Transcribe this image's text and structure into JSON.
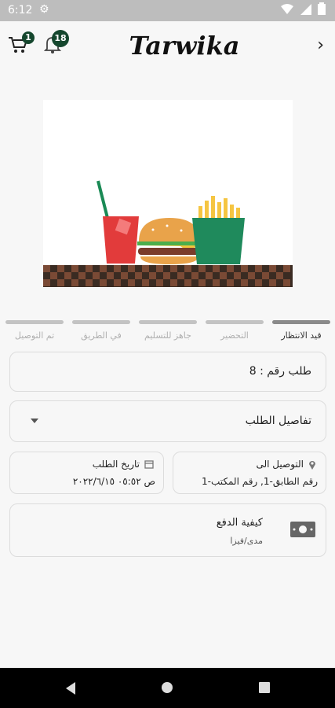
{
  "status_bar": {
    "time": "6:12"
  },
  "app_bar": {
    "logo": "Tarwika",
    "cart_count": "1",
    "notification_count": "18",
    "back_icon": "chevron-right-icon"
  },
  "progress": {
    "steps": [
      {
        "label": "قيد الانتظار",
        "active": true
      },
      {
        "label": "التحضير",
        "active": false
      },
      {
        "label": "جاهز للتسليم",
        "active": false
      },
      {
        "label": "في الطريق",
        "active": false
      },
      {
        "label": "تم التوصيل",
        "active": false
      }
    ]
  },
  "order": {
    "number_text": "طلب رقم : 8"
  },
  "details": {
    "label": "تفاصيل الطلب"
  },
  "delivery": {
    "title": "التوصيل الى",
    "value": "رقم الطابق-1, رقم المكتب-1"
  },
  "order_date": {
    "title": "تاريخ الطلب",
    "value": "ص ٠٥:٥٢ ٢٠٢٢/٦/١٥"
  },
  "payment": {
    "title": "كيفية الدفع",
    "method": "مدى/فيزا"
  },
  "colors": {
    "badge": "#15472e",
    "background": "#f7f7f7"
  }
}
